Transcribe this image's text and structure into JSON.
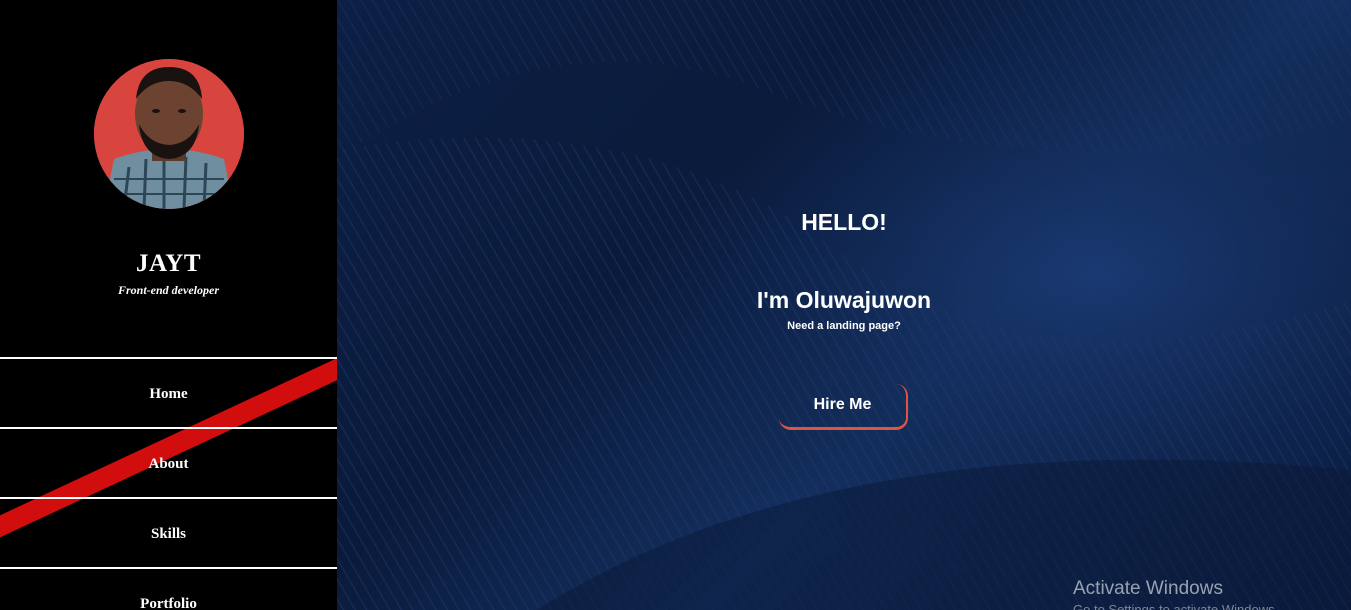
{
  "sidebar": {
    "name": "JAYT",
    "role": "Front-end developer",
    "nav": [
      {
        "label": "Home"
      },
      {
        "label": "About"
      },
      {
        "label": "Skills"
      },
      {
        "label": "Portfolio"
      }
    ]
  },
  "hero": {
    "greeting": "HELLO!",
    "intro": "I'm Oluwajuwon",
    "tagline": "Need a landing page?",
    "cta_label": "Hire Me"
  },
  "os_overlay": {
    "title": "Activate Windows",
    "subtitle": "Go to Settings to activate Windows."
  },
  "colors": {
    "sidebar_bg": "#000000",
    "hero_bg": "#0c1f44",
    "accent": "#e0553f",
    "stripe": "#d10d0d"
  }
}
